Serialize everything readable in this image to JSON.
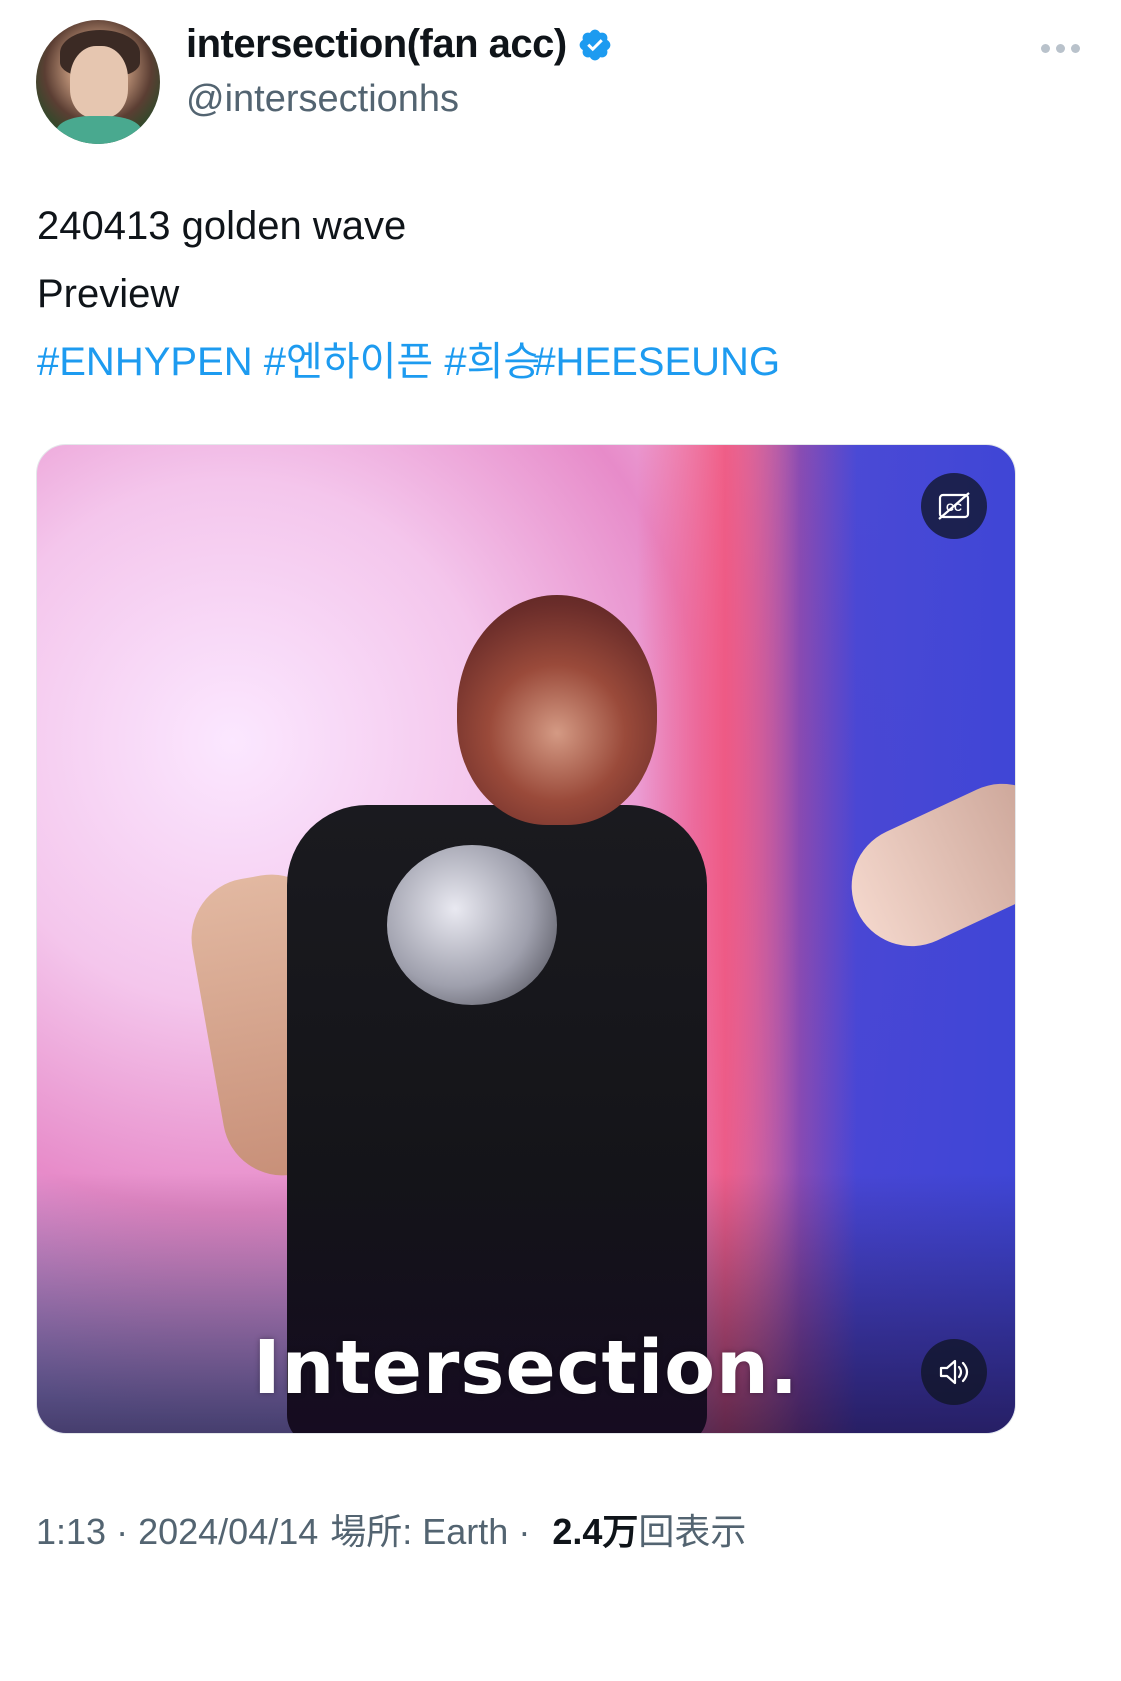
{
  "author": {
    "display_name": "intersection(fan acc)",
    "handle": "@intersectionhs",
    "verified": true
  },
  "tweet": {
    "lines": [
      "240413 golden wave",
      "Preview"
    ],
    "hashtags": [
      "#ENHYPEN",
      "#엔하이픈",
      "#희승",
      "#HEESEUNG"
    ]
  },
  "media": {
    "caption": "Intersection.",
    "buttons": {
      "cc": "captions-off-icon",
      "sound": "sound-on-icon"
    }
  },
  "meta": {
    "time": "1:13",
    "date": "2024/04/14",
    "location_label": "場所: Earth",
    "views_count": "2.4万",
    "views_label": "回表示"
  },
  "colors": {
    "link": "#1d9bf0",
    "verified": "#1d9bf0",
    "secondary_text": "#536471"
  }
}
